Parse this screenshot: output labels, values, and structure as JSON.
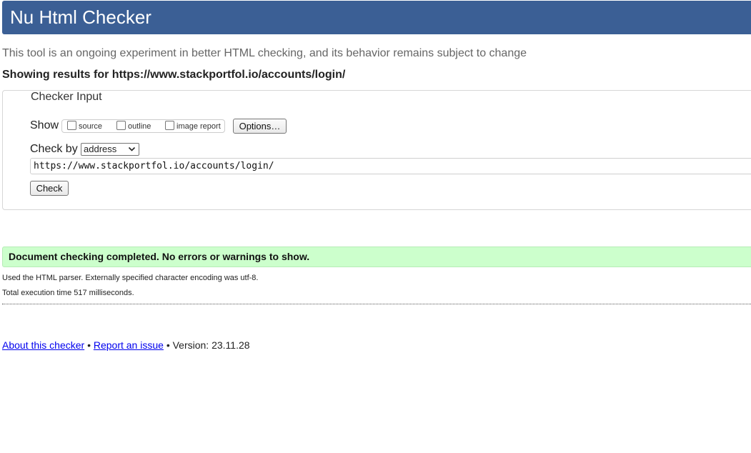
{
  "header": {
    "title": "Nu Html Checker",
    "background_color": "#3b5f95"
  },
  "subtitle": "This tool is an ongoing experiment in better HTML checking, and its behavior remains subject to change",
  "showing_results": "Showing results for https://www.stackportfol.io/accounts/login/",
  "checker_input": {
    "legend": "Checker Input",
    "show_label": "Show",
    "show_options": [
      {
        "label": "source",
        "checked": false
      },
      {
        "label": "outline",
        "checked": false
      },
      {
        "label": "image report",
        "checked": false
      }
    ],
    "options_button": "Options…",
    "check_by_label": "Check by",
    "check_by_selected": "address",
    "url_value": "https://www.stackportfol.io/accounts/login/",
    "check_button": "Check"
  },
  "result": {
    "message": "Document checking completed. No errors or warnings to show.",
    "background_color": "#ccffcc",
    "parser_info": "Used the HTML parser. Externally specified character encoding was utf-8.",
    "execution_time": "Total execution time 517 milliseconds."
  },
  "footer": {
    "about_link": "About this checker",
    "separator": "•",
    "report_link": "Report an issue",
    "version": "Version: 23.11.28"
  }
}
